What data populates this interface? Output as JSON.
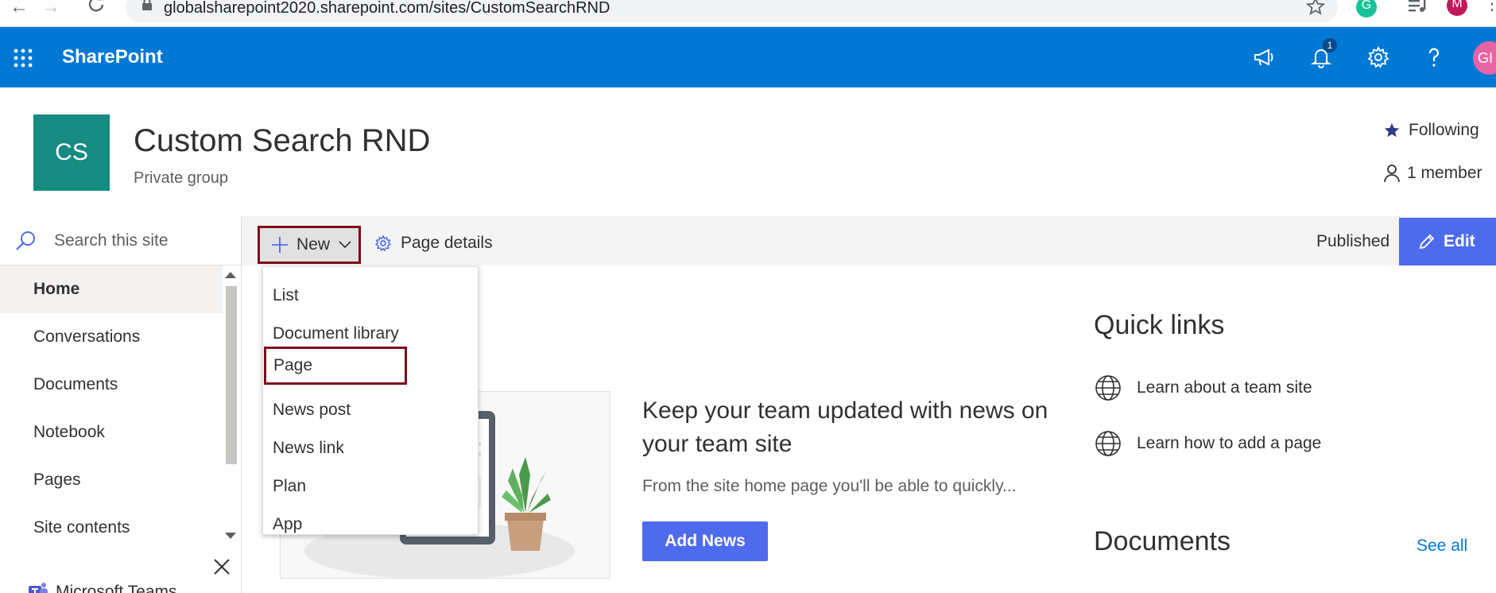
{
  "browser": {
    "url": "globalsharepoint2020.sharepoint.com/sites/CustomSearchRND",
    "profile_initial": "M",
    "grammarly_initial": "G"
  },
  "suite_bar": {
    "brand": "SharePoint",
    "notification_count": "1",
    "user_initials": "GI"
  },
  "site": {
    "logo_initials": "CS",
    "title": "Custom Search RND",
    "subtitle": "Private group",
    "following_label": "Following",
    "member_label": "1 member"
  },
  "command_bar": {
    "new_label": "New",
    "page_details_label": "Page details",
    "status": "Published",
    "edit_label": "Edit"
  },
  "left_nav": {
    "search_placeholder": "Search this site",
    "items": [
      {
        "label": "Home",
        "selected": true
      },
      {
        "label": "Conversations"
      },
      {
        "label": "Documents"
      },
      {
        "label": "Notebook"
      },
      {
        "label": "Pages"
      },
      {
        "label": "Site contents"
      }
    ],
    "teams_label": "Microsoft Teams"
  },
  "new_menu": {
    "items": [
      "List",
      "Document library",
      "Page",
      "News post",
      "News link",
      "Plan",
      "App"
    ],
    "highlighted": "Page"
  },
  "news": {
    "heading": "Keep your team updated with news on your team site",
    "description": "From the site home page you'll be able to quickly...",
    "add_button": "Add News"
  },
  "quick_links": {
    "title": "Quick links",
    "items": [
      "Learn about a team site",
      "Learn how to add a page"
    ]
  },
  "documents": {
    "title": "Documents",
    "see_all": "See all"
  },
  "colors": {
    "suite_blue": "#0078d4",
    "accent": "#4f6bed",
    "site_logo": "#168b82",
    "highlight_border": "#7d0c1b"
  }
}
